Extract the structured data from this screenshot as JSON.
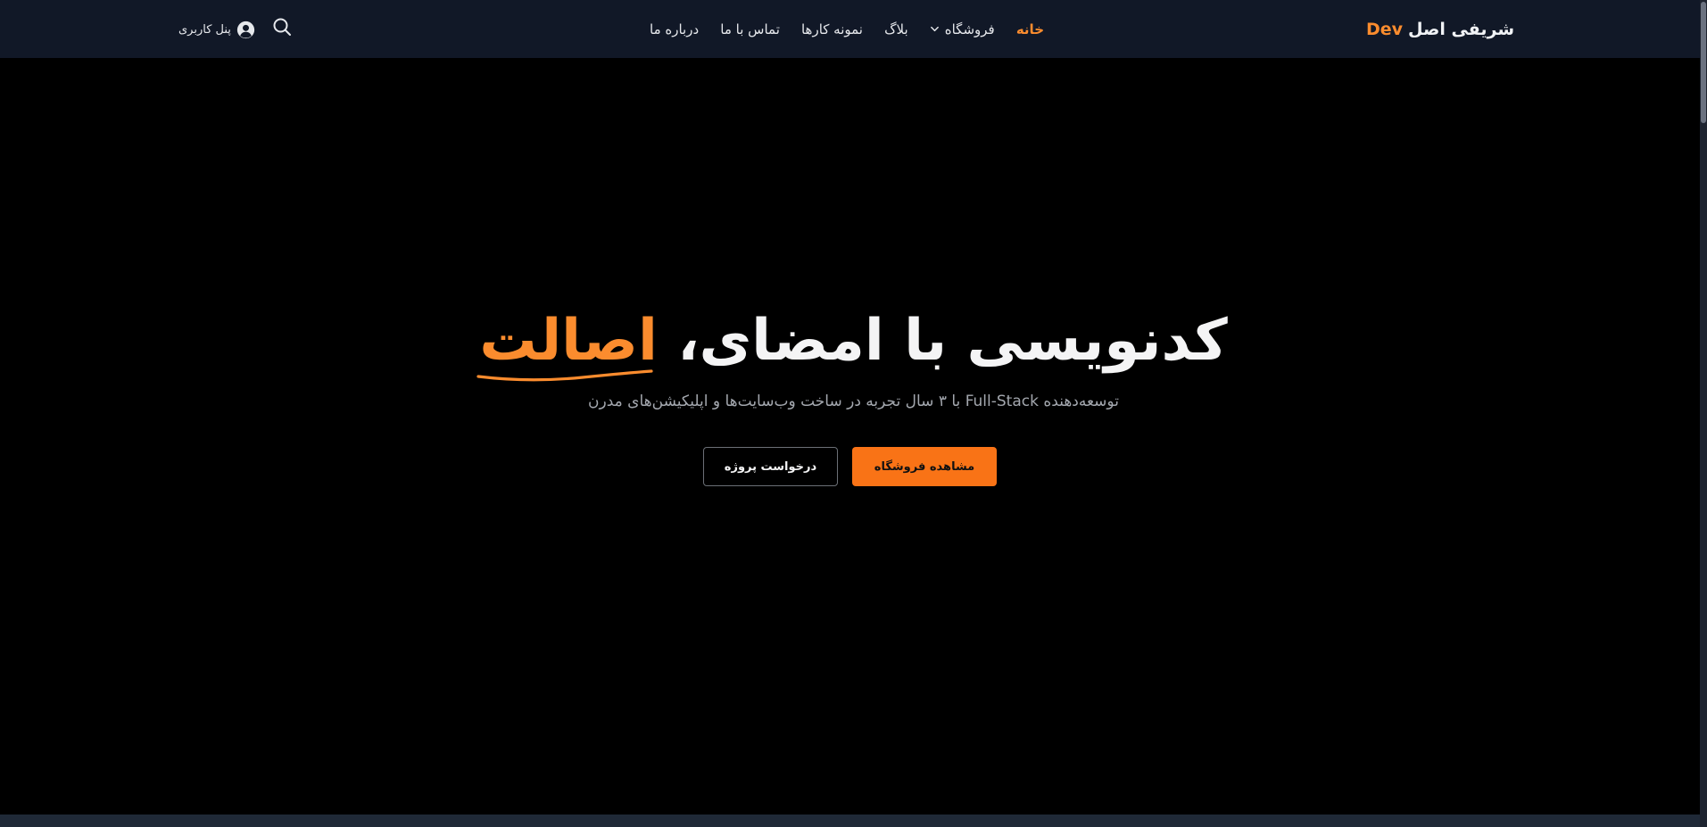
{
  "header": {
    "brand_name": "شریفی اصل",
    "brand_accent": "Dev",
    "nav": {
      "home": "خانه",
      "shop": "فروشگاه",
      "blog": "بلاگ",
      "portfolio": "نمونه کارها",
      "contact": "تماس با ما",
      "about": "درباره ما"
    },
    "user_panel_label": "پنل کاربری"
  },
  "hero": {
    "title": "کدنویسی با امضای،",
    "title_highlight": "اصالت",
    "subtitle": "توسعه‌دهنده Full-Stack با ۳ سال تجربه در ساخت وب‌سایت‌ها و اپلیکیشن‌های مدرن",
    "primary_button": "مشاهده فروشگاه",
    "secondary_button": "درخواست پروژه"
  },
  "colors": {
    "accent": "#fb8c2e",
    "header_bg": "#111827",
    "page_bg": "#000000",
    "button_primary": "#f97316"
  },
  "icons": {
    "search": "search-icon",
    "user": "user-circle-icon",
    "chevron": "chevron-down-icon"
  }
}
